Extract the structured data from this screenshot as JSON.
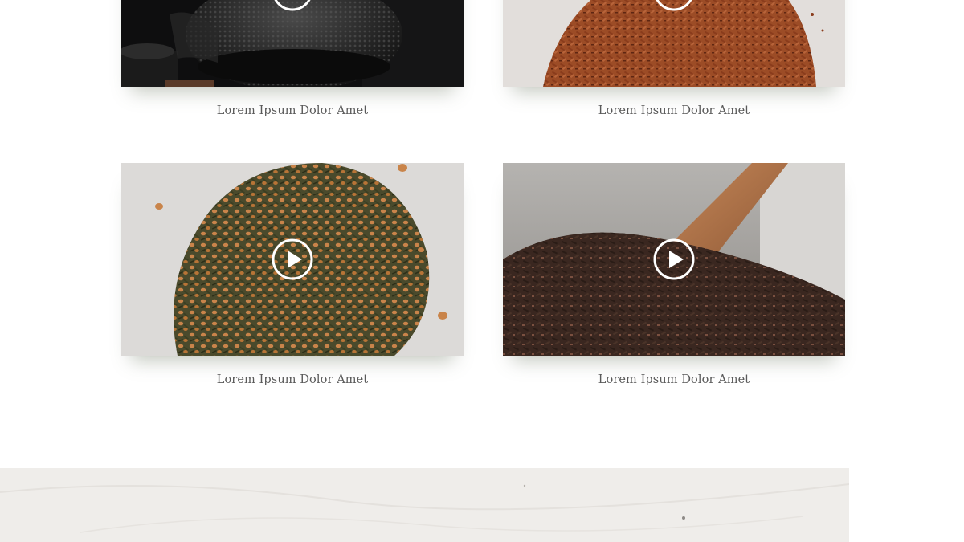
{
  "gallery": {
    "items": [
      {
        "caption": "Lorem Ipsum Dolor Amet",
        "image": "iron-teapot-image",
        "play_icon": "play-icon"
      },
      {
        "caption": "Lorem Ipsum Dolor Amet",
        "image": "rooibos-tea-image",
        "play_icon": "play-icon"
      },
      {
        "caption": "Lorem Ipsum Dolor Amet",
        "image": "genmaicha-tea-image",
        "play_icon": "play-icon"
      },
      {
        "caption": "Lorem Ipsum Dolor Amet",
        "image": "black-tea-scoop-image",
        "play_icon": "play-icon"
      }
    ]
  },
  "colors": {
    "caption_text": "#5a5a5a",
    "background": "#ffffff",
    "band": "#efedea"
  }
}
